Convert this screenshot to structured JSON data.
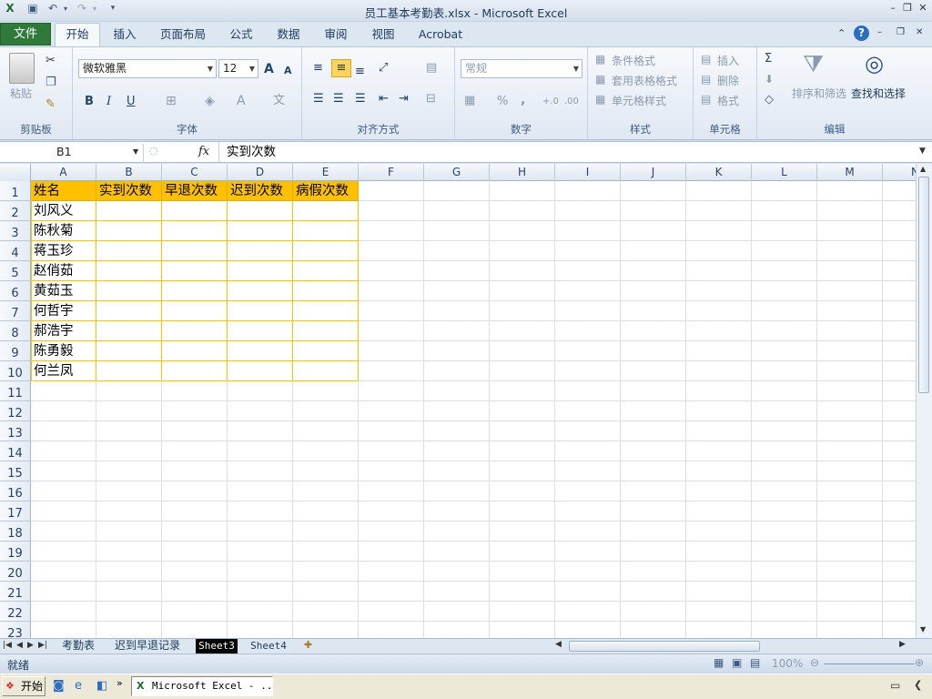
{
  "window": {
    "title": "员工基本考勤表.xlsx - Microsoft Excel"
  },
  "tabs": {
    "file": "文件",
    "home": "开始",
    "insert": "插入",
    "layout": "页面布局",
    "formulas": "公式",
    "data": "数据",
    "review": "审阅",
    "view": "视图",
    "acrobat": "Acrobat"
  },
  "ribbon": {
    "clipboard": {
      "label": "剪贴板",
      "paste": "粘贴"
    },
    "font": {
      "label": "字体",
      "name": "微软雅黑",
      "size": "12",
      "bold": "B",
      "italic": "I",
      "underline": "U",
      "grow": "A",
      "shrink": "A"
    },
    "alignment": {
      "label": "对齐方式"
    },
    "number": {
      "label": "数字",
      "format": "常规",
      "percent": "%",
      "comma": ",",
      "inc": "+.0",
      "dec": ".00"
    },
    "styles": {
      "label": "样式",
      "conditional": "条件格式",
      "table": "套用表格格式",
      "cell": "单元格样式"
    },
    "cells": {
      "label": "单元格",
      "insert": "插入",
      "delete": "删除",
      "format": "格式"
    },
    "editing": {
      "label": "编辑",
      "sort": "排序和筛选",
      "find": "查找和选择",
      "sum": "Σ"
    }
  },
  "formula_bar": {
    "name_box": "B1",
    "fx": "fx",
    "content": "实到次数"
  },
  "grid": {
    "columns": [
      "A",
      "B",
      "C",
      "D",
      "E",
      "F",
      "G",
      "H",
      "I",
      "J",
      "K",
      "L",
      "M",
      "N"
    ],
    "rows": [
      "1",
      "2",
      "3",
      "4",
      "5",
      "6",
      "7",
      "8",
      "9",
      "10",
      "11",
      "12",
      "13",
      "14",
      "15",
      "16",
      "17",
      "18",
      "19",
      "20",
      "21",
      "22",
      "23"
    ],
    "header_row": [
      "姓名",
      "实到次数",
      "早退次数",
      "迟到次数",
      "病假次数"
    ],
    "names": [
      "刘风义",
      "陈秋菊",
      "蒋玉珍",
      "赵俏茹",
      "黄茹玉",
      "何哲宇",
      "郝浩宇",
      "陈勇毅",
      "何兰凤"
    ]
  },
  "sheets": [
    "考勤表",
    "迟到早退记录",
    "Sheet3",
    "Sheet4"
  ],
  "status": {
    "ready": "就绪",
    "zoom": "100%"
  },
  "taskbar": {
    "start": "开始",
    "app": "Microsoft Excel - ..."
  },
  "colors": {
    "header_fill": "#ffc000",
    "file_tab": "#2f7a3a"
  }
}
